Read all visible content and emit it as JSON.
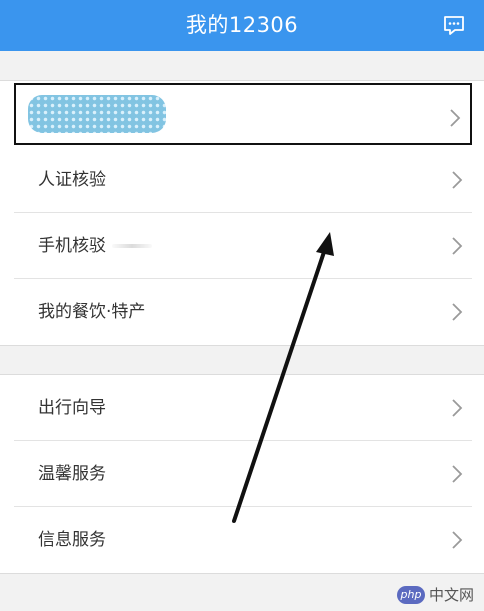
{
  "header": {
    "title": "我的12306",
    "message_icon": "chat-bubble-icon"
  },
  "account_group": {
    "rows": [
      {
        "label": ""
      },
      {
        "label": "人证核验"
      },
      {
        "label": "手机核驳"
      },
      {
        "label": "我的餐饮·特产"
      }
    ]
  },
  "service_group": {
    "rows": [
      {
        "label": "出行向导"
      },
      {
        "label": "温馨服务"
      },
      {
        "label": "信息服务"
      }
    ]
  },
  "watermark": {
    "logo": "php",
    "text": "中文网"
  },
  "colors": {
    "header_bg": "#3a95ee",
    "page_bg": "#f2f2f2",
    "row_text": "#333333",
    "annotation": "#111111"
  }
}
